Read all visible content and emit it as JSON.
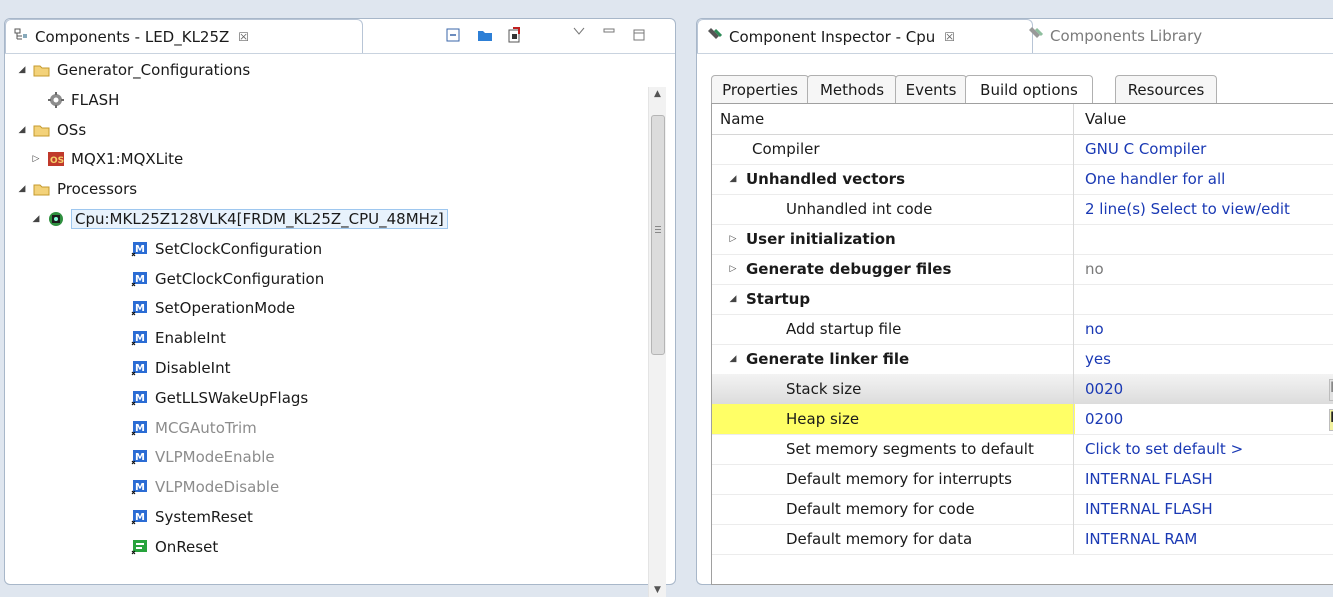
{
  "left": {
    "tab_title": "Components - LED_KL25Z",
    "close": "☒",
    "tree": [
      {
        "label": "Generator_Configurations",
        "icon": "folder-icon",
        "indent": 0,
        "twisty": "◢"
      },
      {
        "label": "FLASH",
        "icon": "gear-icon",
        "indent": 1,
        "twisty": ""
      },
      {
        "label": "OSs",
        "icon": "folder-icon",
        "indent": 0,
        "twisty": "◢"
      },
      {
        "label": "MQX1:MQXLite",
        "icon": "os-icon",
        "indent": 1,
        "twisty": "▷"
      },
      {
        "label": "Processors",
        "icon": "folder-icon",
        "indent": 0,
        "twisty": "◢"
      },
      {
        "label": "Cpu:MKL25Z128VLK4[FRDM_KL25Z_CPU_48MHz]",
        "icon": "cpu-icon",
        "indent": 1,
        "twisty": "◢",
        "selected": true
      },
      {
        "label": "SetClockConfiguration",
        "icon": "method-icon",
        "indent": 2
      },
      {
        "label": "GetClockConfiguration",
        "icon": "method-icon",
        "indent": 2
      },
      {
        "label": "SetOperationMode",
        "icon": "method-icon",
        "indent": 2
      },
      {
        "label": "EnableInt",
        "icon": "method-icon",
        "indent": 2
      },
      {
        "label": "DisableInt",
        "icon": "method-icon",
        "indent": 2
      },
      {
        "label": "GetLLSWakeUpFlags",
        "icon": "method-icon",
        "indent": 2
      },
      {
        "label": "MCGAutoTrim",
        "icon": "method-icon",
        "indent": 2,
        "disabled": true
      },
      {
        "label": "VLPModeEnable",
        "icon": "method-icon",
        "indent": 2,
        "disabled": true
      },
      {
        "label": "VLPModeDisable",
        "icon": "method-icon",
        "indent": 2,
        "disabled": true
      },
      {
        "label": "SystemReset",
        "icon": "method-icon",
        "indent": 2
      },
      {
        "label": "OnReset",
        "icon": "event-icon",
        "indent": 2
      }
    ]
  },
  "right": {
    "tab_inspector": "Component Inspector - Cpu",
    "close": "☒",
    "tab_library": "Components Library",
    "subtabs": [
      "Properties",
      "Methods",
      "Events",
      "Build options",
      "Resources"
    ],
    "grid_header": {
      "name": "Name",
      "value": "Value"
    },
    "rows": [
      {
        "name": "Compiler",
        "value": "GNU C Compiler",
        "twisty": "",
        "bold": false,
        "level": 1
      },
      {
        "name": "Unhandled vectors",
        "value": "One handler for all",
        "twisty": "◢",
        "bold": true,
        "level": 0
      },
      {
        "name": "Unhandled int code",
        "value": "2 line(s)   Select to view/edit",
        "twisty": "",
        "bold": false,
        "level": 2
      },
      {
        "name": "User initialization",
        "value": "",
        "twisty": "▷",
        "bold": true,
        "level": 0
      },
      {
        "name": "Generate debugger files",
        "value": "no",
        "twisty": "▷",
        "bold": true,
        "level": 0,
        "grey": true
      },
      {
        "name": "Startup",
        "value": "",
        "twisty": "◢",
        "bold": true,
        "level": 0
      },
      {
        "name": "Add startup file",
        "value": "no",
        "twisty": "",
        "bold": false,
        "level": 2
      },
      {
        "name": "Generate linker file",
        "value": "yes",
        "twisty": "◢",
        "bold": true,
        "level": 0
      },
      {
        "name": "Stack size",
        "value": "0020",
        "twisty": "",
        "bold": false,
        "level": 2,
        "style": "grey-row",
        "hbtn": "H"
      },
      {
        "name": "Heap size",
        "value": "0200",
        "twisty": "",
        "bold": false,
        "level": 2,
        "style": "hl",
        "hbtn": "H"
      },
      {
        "name": "Set memory segments to default",
        "value": "Click to set default >",
        "twisty": "",
        "bold": false,
        "level": 2
      },
      {
        "name": "Default memory for interrupts",
        "value": "INTERNAL FLASH",
        "twisty": "",
        "bold": false,
        "level": 2
      },
      {
        "name": "Default memory for code",
        "value": "INTERNAL FLASH",
        "twisty": "",
        "bold": false,
        "level": 2
      },
      {
        "name": "Default memory for data",
        "value": "INTERNAL RAM",
        "twisty": "",
        "bold": false,
        "level": 2
      }
    ]
  }
}
